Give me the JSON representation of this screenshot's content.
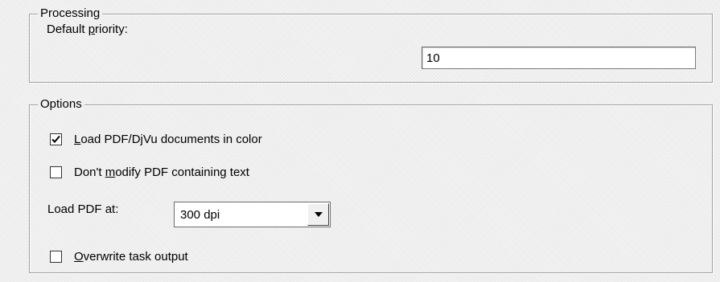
{
  "processing": {
    "title": "Processing",
    "default_priority": {
      "label_pre": "Default ",
      "label_accel": "p",
      "label_post": "riority:",
      "value": "10"
    }
  },
  "options": {
    "title": "Options",
    "load_color": {
      "accel": "L",
      "rest": "oad PDF/DjVu documents in color",
      "checked": true
    },
    "dont_modify": {
      "pre": "Don't ",
      "accel": "m",
      "rest": "odify PDF containing text",
      "checked": false
    },
    "load_pdf_at": {
      "label": "Load PDF at:",
      "selected": "300 dpi"
    },
    "overwrite": {
      "accel": "O",
      "rest": "verwrite task output",
      "checked": false
    }
  },
  "icons": {
    "check": "check-icon",
    "dropdown": "dropdown-arrow-icon"
  },
  "colors": {
    "background": "#f0f0f0",
    "border": "#a0a0a0"
  }
}
